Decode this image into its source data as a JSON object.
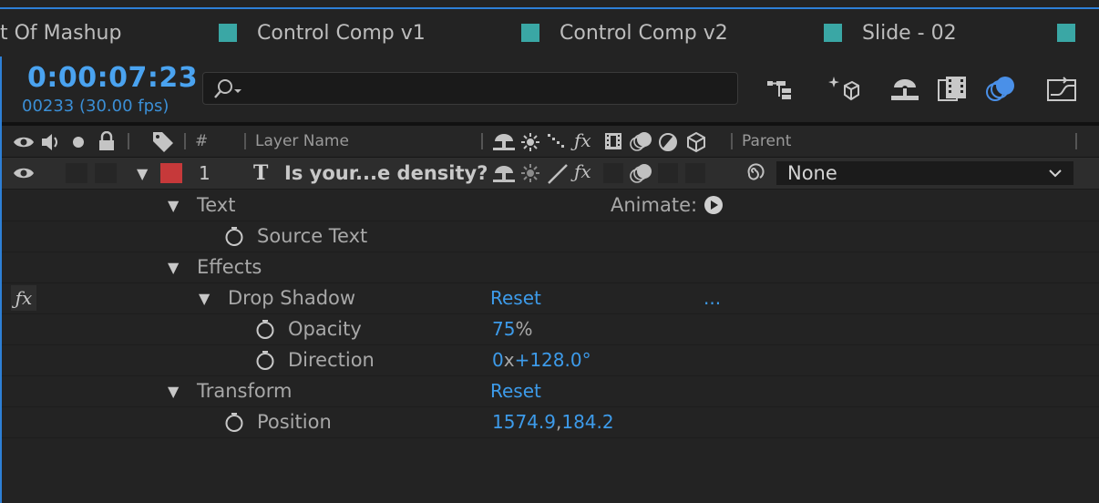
{
  "tabs": [
    {
      "label": "t Of Mashup",
      "has_swatch": false
    },
    {
      "label": "Control Comp v1",
      "has_swatch": true
    },
    {
      "label": "Control Comp v2",
      "has_swatch": true
    },
    {
      "label": "Slide - 02",
      "has_swatch": true
    },
    {
      "label": "",
      "has_swatch": true
    }
  ],
  "header": {
    "timecode": "0:00:07:23",
    "frames": "00233 (30.00 fps)",
    "search_placeholder": ""
  },
  "toolbar": {
    "icons": [
      "composition-flowchart-icon",
      "draft-3d-icon",
      "shy-layers-icon",
      "frame-blending-icon",
      "motion-blur-icon",
      "graph-editor-icon"
    ],
    "active": "motion-blur-icon"
  },
  "columns": {
    "number": "#",
    "layer_name": "Layer Name",
    "parent": "Parent"
  },
  "layer": {
    "number": "1",
    "type_glyph": "T",
    "name": "Is your...e density?",
    "label_color": "#c6393a",
    "parent": "None"
  },
  "properties": {
    "text": "Text",
    "animate": "Animate:",
    "source_text": "Source Text",
    "effects": "Effects",
    "drop_shadow": "Drop Shadow",
    "drop_shadow_reset": "Reset",
    "drop_shadow_more": "...",
    "opacity_label": "Opacity",
    "opacity_value": "75",
    "opacity_unit": "%",
    "direction_label": "Direction",
    "direction_rev": "0",
    "direction_x": "x",
    "direction_deg": "+128.0°",
    "transform": "Transform",
    "transform_reset": "Reset",
    "position_label": "Position",
    "position_x": "1574.9",
    "position_comma": ",",
    "position_y": "184.2"
  },
  "colors": {
    "accent": "#3d9bea",
    "background": "#232323",
    "tab_swatch": "#3aa7a5"
  }
}
